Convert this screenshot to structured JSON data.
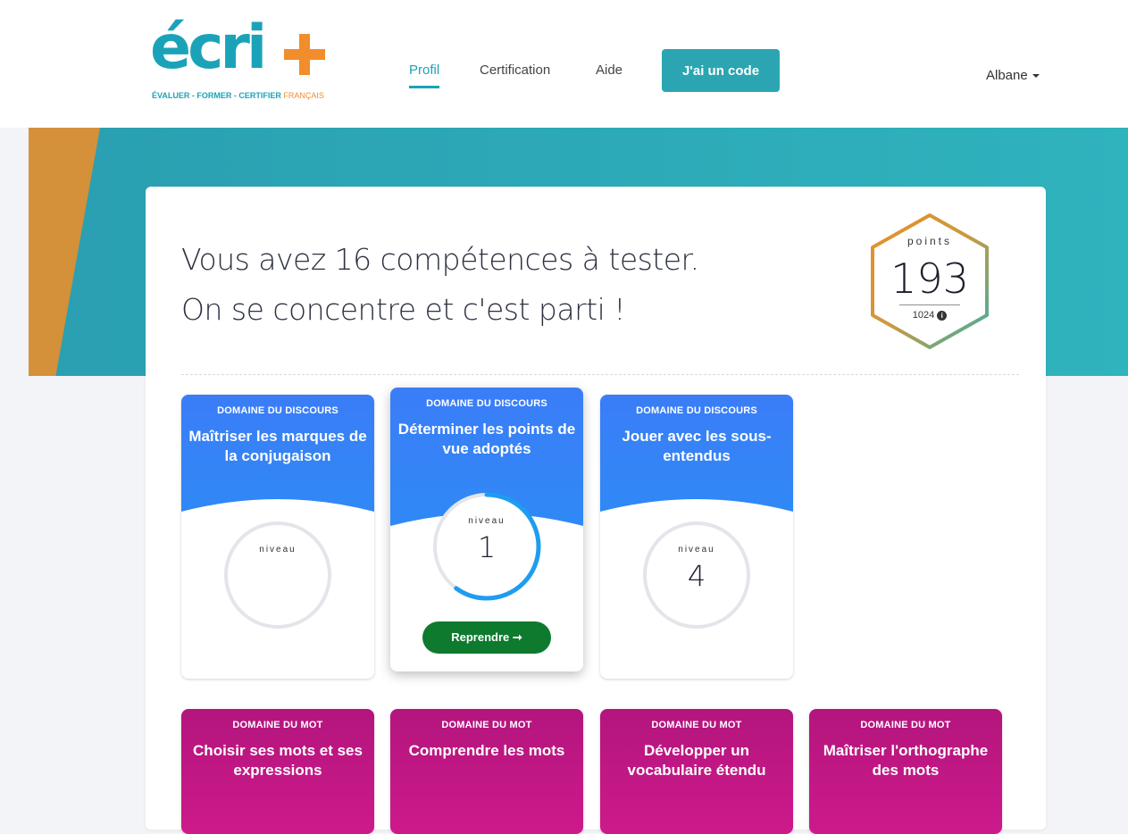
{
  "header": {
    "logo": {
      "wordmark": "écri",
      "tagline_main": "ÉVALUER - FORMER - CERTIFIER",
      "tagline_lang": "FRANÇAIS"
    },
    "nav": [
      {
        "label": "Profil",
        "active": true
      },
      {
        "label": "Certification",
        "active": false
      },
      {
        "label": "Aide",
        "active": false
      }
    ],
    "code_button": "J'ai un code",
    "user_name": "Albane"
  },
  "colors": {
    "accent": "#2ba5b2",
    "orange": "#f18d2b",
    "blue_card": "#3b7df7",
    "pink_card": "#c4187f",
    "resume": "#0e7a2e"
  },
  "main": {
    "heading_line1": "Vous avez 16 compétences à tester.",
    "heading_line2": "On se concentre et c'est parti !",
    "points": {
      "label": "points",
      "value": "193",
      "total": "1024",
      "info_icon": "info-circle-icon"
    }
  },
  "cards": [
    {
      "domain": "DOMAINE DU DISCOURS",
      "title": "Maîtriser les marques de la conjugaison",
      "level_label": "niveau",
      "level": "",
      "progress": 0
    },
    {
      "domain": "DOMAINE DU DISCOURS",
      "title": "Déterminer les points de vue adoptés",
      "level_label": "niveau",
      "level": "1",
      "progress": 0.6,
      "button": "Reprendre ➞"
    },
    {
      "domain": "DOMAINE DU DISCOURS",
      "title": "Jouer avec les sous-entendus",
      "level_label": "niveau",
      "level": "4",
      "progress": 0
    },
    {
      "domain": "DOMAINE DU MOT",
      "title": "Choisir ses mots et ses expressions"
    },
    {
      "domain": "DOMAINE DU MOT",
      "title": "Comprendre les mots"
    },
    {
      "domain": "DOMAINE DU MOT",
      "title": "Développer un vocabulaire étendu"
    },
    {
      "domain": "DOMAINE DU MOT",
      "title": "Maîtriser l'orthographe des mots"
    }
  ]
}
